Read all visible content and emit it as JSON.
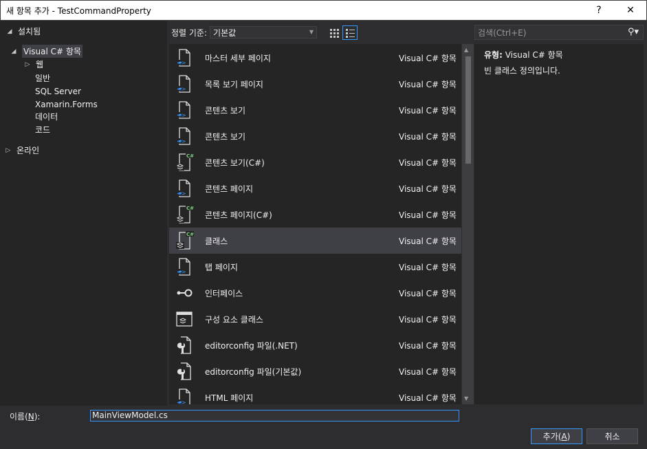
{
  "window": {
    "title": "새 항목 추가 - TestCommandProperty",
    "help_label": "?",
    "close_label": "✕"
  },
  "tree": {
    "installed": "설치됨",
    "visual_cs": "Visual C# 항목",
    "web": "웹",
    "children": [
      "일반",
      "SQL Server",
      "Xamarin.Forms",
      "데이터",
      "코드"
    ],
    "online": "온라인"
  },
  "sort": {
    "label": "정렬 기준:",
    "value": "기본값"
  },
  "search": {
    "placeholder": "검색(Ctrl+E)"
  },
  "items": [
    {
      "name": "마스터 세부 페이지",
      "category": "Visual C# 항목",
      "icon": "xaml-page-icon"
    },
    {
      "name": "목록 보기 페이지",
      "category": "Visual C# 항목",
      "icon": "xaml-page-icon"
    },
    {
      "name": "콘텐츠 보기",
      "category": "Visual C# 항목",
      "icon": "xaml-page-icon"
    },
    {
      "name": "콘텐츠 보기",
      "category": "Visual C# 항목",
      "icon": "xaml-page-icon"
    },
    {
      "name": "콘텐츠 보기(C#)",
      "category": "Visual C# 항목",
      "icon": "csharp-class-icon"
    },
    {
      "name": "콘텐츠 페이지",
      "category": "Visual C# 항목",
      "icon": "xaml-page-icon"
    },
    {
      "name": "콘텐츠 페이지(C#)",
      "category": "Visual C# 항목",
      "icon": "csharp-class-icon"
    },
    {
      "name": "클래스",
      "category": "Visual C# 항목",
      "icon": "csharp-class-icon"
    },
    {
      "name": "탭 페이지",
      "category": "Visual C# 항목",
      "icon": "xaml-page-icon"
    },
    {
      "name": "인터페이스",
      "category": "Visual C# 항목",
      "icon": "interface-icon"
    },
    {
      "name": "구성 요소 클래스",
      "category": "Visual C# 항목",
      "icon": "component-class-icon"
    },
    {
      "name": "editorconfig 파일(.NET)",
      "category": "Visual C# 항목",
      "icon": "config-file-icon"
    },
    {
      "name": "editorconfig 파일(기본값)",
      "category": "Visual C# 항목",
      "icon": "config-file-icon"
    },
    {
      "name": "HTML 페이지",
      "category": "Visual C# 항목",
      "icon": "xaml-page-icon"
    }
  ],
  "selected_item_index": 7,
  "details": {
    "type_label": "유형:",
    "type_value": "Visual C# 항목",
    "description": "빈 클래스 정의입니다."
  },
  "name_field": {
    "label_prefix": "이름(",
    "label_key": "N",
    "label_suffix": "):",
    "value": "MainViewModel.cs"
  },
  "buttons": {
    "add_prefix": "추가(",
    "add_key": "A",
    "add_suffix": ")",
    "cancel": "취소"
  },
  "colors": {
    "accent": "#3399ff",
    "background": "#2d2d30",
    "panel": "#252526",
    "selection": "#3f3f46",
    "csharp_badge": "#7dd17d"
  }
}
